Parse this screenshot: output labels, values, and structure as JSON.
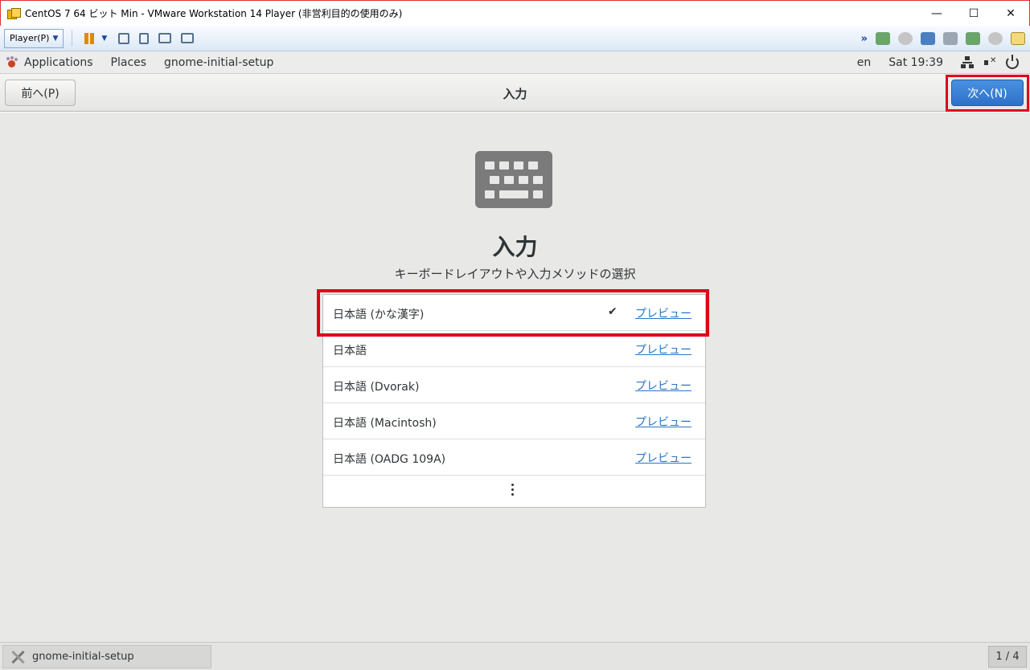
{
  "window": {
    "title": "CentOS 7 64 ビット Min - VMware Workstation 14 Player (非営利目的の使用のみ)",
    "controls": [
      "minimize",
      "maximize",
      "close"
    ]
  },
  "vm_toolbar": {
    "player_label": "Player(P)",
    "icons": [
      "pause-icon",
      "send-ctrl-alt-del-icon",
      "removable-devices-icon",
      "fullscreen-icon",
      "unity-icon"
    ],
    "device_icons": [
      "hard-disk-icon",
      "cd-icon",
      "network-icon",
      "printer-icon",
      "sound-icon",
      "webcam-icon",
      "message-log-icon"
    ]
  },
  "gnome_bar": {
    "applications": "Applications",
    "places": "Places",
    "app_name": "gnome-initial-setup",
    "lang": "en",
    "clock": "Sat 19:39"
  },
  "header": {
    "back_label": "前へ(P)",
    "title": "入力",
    "next_label": "次へ(N)"
  },
  "main": {
    "title": "入力",
    "subtitle": "キーボードレイアウトや入力メソッドの選択",
    "sources": [
      {
        "label": "日本語 (かな漢字)",
        "selected": true,
        "preview": "プレビュー"
      },
      {
        "label": "日本語",
        "selected": false,
        "preview": "プレビュー"
      },
      {
        "label": "日本語 (Dvorak)",
        "selected": false,
        "preview": "プレビュー"
      },
      {
        "label": "日本語 (Macintosh)",
        "selected": false,
        "preview": "プレビュー"
      },
      {
        "label": "日本語 (OADG 109A)",
        "selected": false,
        "preview": "プレビュー"
      }
    ],
    "check_mark": "✔"
  },
  "taskbar": {
    "task_label": "gnome-initial-setup",
    "pager": "1 / 4"
  },
  "colors": {
    "highlight": "#e0001b",
    "accent": "#2d72c9",
    "link": "#2a76c6"
  }
}
